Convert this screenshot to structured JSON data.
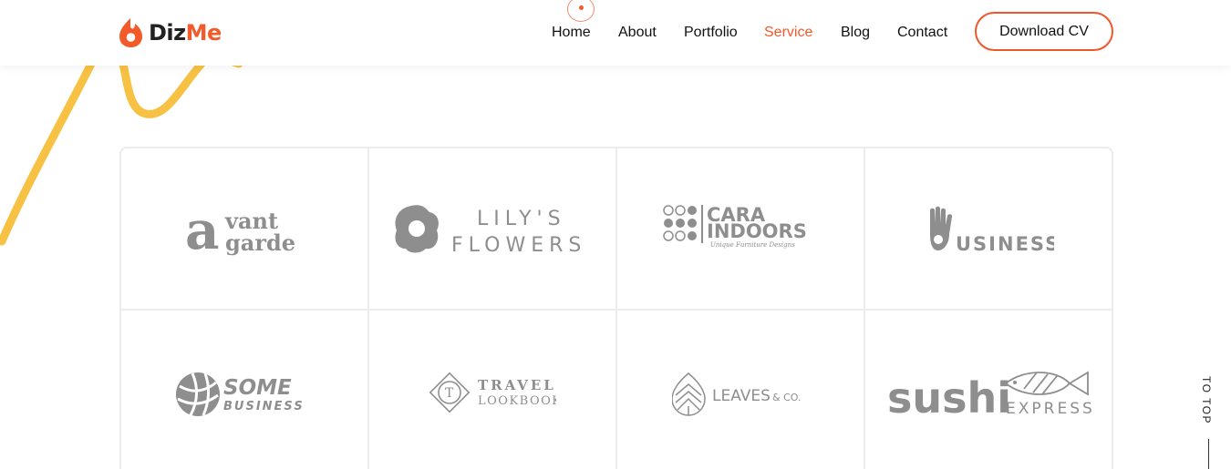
{
  "logo": {
    "part1": "Diz",
    "part2": "Me"
  },
  "nav": {
    "items": [
      {
        "label": "Home"
      },
      {
        "label": "About"
      },
      {
        "label": "Portfolio"
      },
      {
        "label": "Service"
      },
      {
        "label": "Blog"
      },
      {
        "label": "Contact"
      }
    ],
    "active": "Service",
    "cta_label": "Download CV"
  },
  "brands": [
    {
      "name": "avant garde",
      "lines": [
        "vant",
        "garde"
      ],
      "initial": "a"
    },
    {
      "name": "LILY'S FLOWERS",
      "lines": [
        "LILY'S",
        "FLOWERS"
      ]
    },
    {
      "name": "CARA INDOORS",
      "lines": [
        "CARA",
        "INDOORS"
      ],
      "tagline": "Unique Furniture Designs"
    },
    {
      "name": "BUSINESS",
      "lines": [
        "USINESS"
      ]
    },
    {
      "name": "SOME BUSINESS",
      "lines": [
        "SOME",
        "BUSINESS"
      ]
    },
    {
      "name": "TRAVEL LOOKBOOK",
      "lines": [
        "TRAVEL",
        "LOOKBOOK"
      ],
      "badge": "T"
    },
    {
      "name": "LEAVES & CO.",
      "lines": [
        "LEAVES",
        "& CO."
      ]
    },
    {
      "name": "sushi EXPRESS",
      "lines": [
        "sushi",
        "EXPRESS"
      ]
    }
  ],
  "to_top_label": "TO TOP",
  "colors": {
    "accent": "#f25a2a",
    "squiggle": "#f7c244",
    "logo_gray": "#8e8e8e",
    "border": "#ececec"
  }
}
